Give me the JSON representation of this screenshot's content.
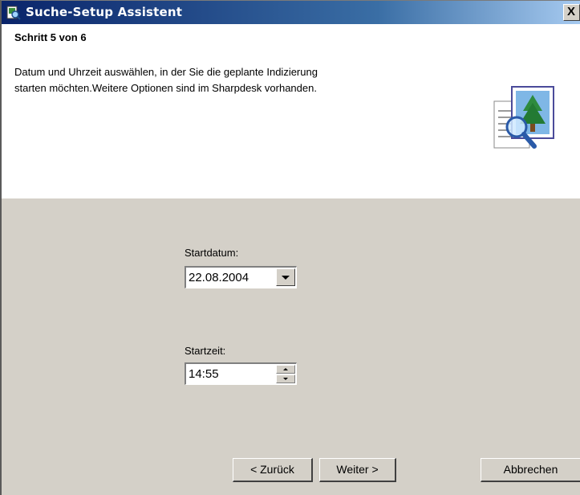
{
  "window": {
    "title": "Suche-Setup Assistent",
    "close_label": "X"
  },
  "header": {
    "step": "Schritt 5 von 6",
    "description_line1": "Datum und Uhrzeit auswählen, in der Sie die geplante Indizierung",
    "description_line2": "starten möchten.Weitere Optionen sind im Sharpdesk vorhanden."
  },
  "form": {
    "start_date_label": "Startdatum:",
    "start_date_value": "22.08.2004",
    "start_time_label": "Startzeit:",
    "start_time_value": "14:55"
  },
  "buttons": {
    "back": "< Zurück",
    "next": "Weiter >",
    "cancel": "Abbrechen"
  },
  "icons": {
    "app": "search-app-icon",
    "wizard": "document-magnifier-icon"
  },
  "colors": {
    "titlebar_start": "#0a246a",
    "titlebar_end": "#a6caf0",
    "dialog_face": "#d4d0c8",
    "header_bg": "#ffffff"
  }
}
